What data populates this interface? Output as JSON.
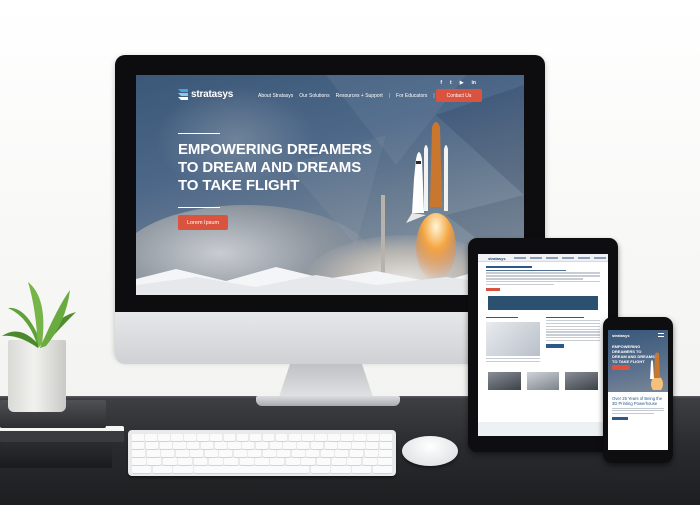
{
  "site": {
    "logo_text": "stratasys",
    "social_icons": [
      "facebook-icon",
      "twitter-icon",
      "video-icon",
      "linkedin-icon"
    ],
    "social_glyphs": [
      "f",
      "t",
      "▶",
      "in"
    ],
    "nav": [
      "About Stratasys",
      "Our Solutions",
      "Resources + Support",
      "|",
      "For Educators",
      "|"
    ],
    "contact_label": "Contact Us",
    "hero_title_lines": [
      "EMPOWERING DREAMERS",
      "TO DREAM AND DREAMS",
      "TO TAKE FLIGHT"
    ],
    "hero_button": "Lorem Ipsum"
  },
  "phone": {
    "hero_title": "EMPOWERING DREAMERS TO DREAM AND DREAMS TO TAKE FLIGHT",
    "headline": "Over 25 Years of Being the 3D Printing Powerhouse"
  },
  "colors": {
    "accent": "#d9533f",
    "brand_blue": "#2b5a8a",
    "desk": "#2a2b2e"
  }
}
